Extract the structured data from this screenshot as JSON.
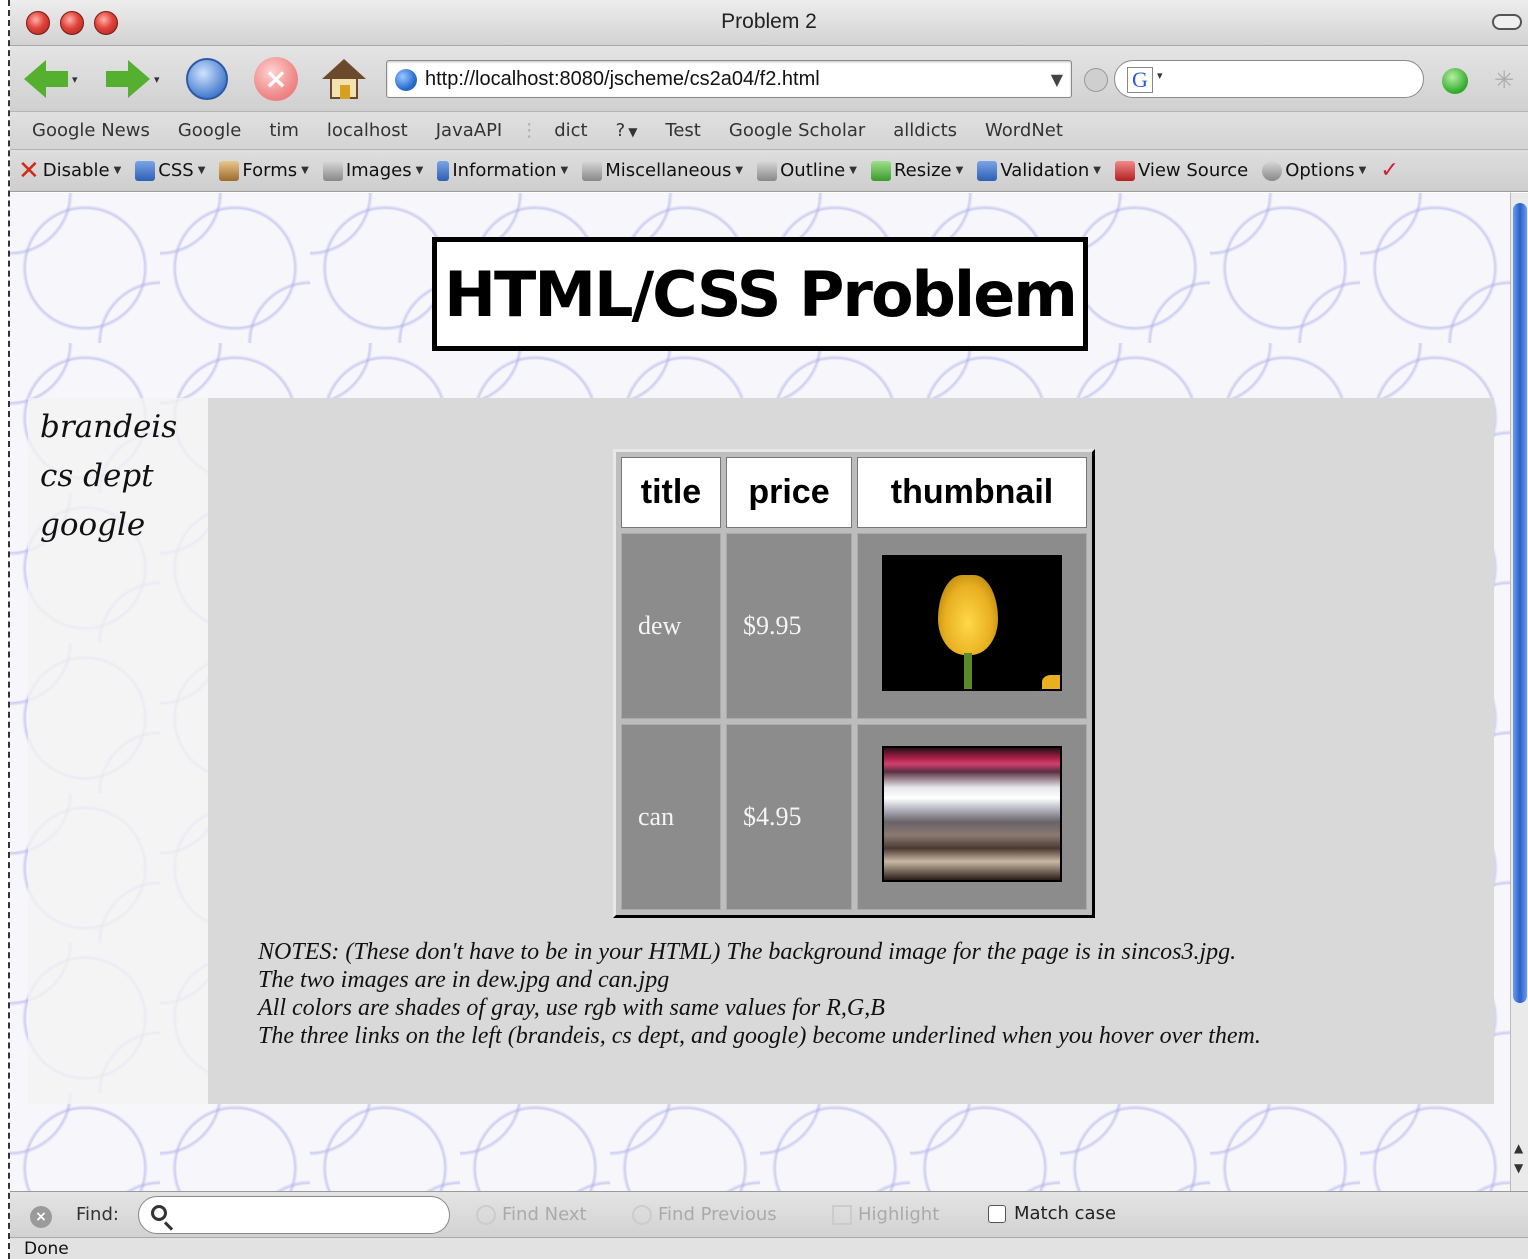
{
  "window": {
    "title": "Problem 2"
  },
  "navigation": {
    "url": "http://localhost:8080/jscheme/cs2a04/f2.html",
    "search_placeholder": ""
  },
  "bookmarks": [
    "Google News",
    "Google",
    "tim",
    "localhost",
    "JavaAPI",
    "dict",
    "?",
    "Test",
    "Google Scholar",
    "alldicts",
    "WordNet"
  ],
  "devbar": {
    "items": [
      {
        "label": "Disable",
        "icon": "x-icon"
      },
      {
        "label": "CSS",
        "icon": "css-icon"
      },
      {
        "label": "Forms",
        "icon": "forms-icon"
      },
      {
        "label": "Images",
        "icon": "images-icon"
      },
      {
        "label": "Information",
        "icon": "information-icon"
      },
      {
        "label": "Miscellaneous",
        "icon": "miscellaneous-icon"
      },
      {
        "label": "Outline",
        "icon": "outline-icon"
      },
      {
        "label": "Resize",
        "icon": "resize-icon"
      },
      {
        "label": "Validation",
        "icon": "validation-icon"
      },
      {
        "label": "View Source",
        "icon": "view-source-icon"
      },
      {
        "label": "Options",
        "icon": "options-icon"
      }
    ]
  },
  "page": {
    "heading": "HTML/CSS Problem",
    "links": [
      "brandeis",
      "cs dept",
      "google"
    ],
    "table": {
      "headers": [
        "title",
        "price",
        "thumbnail"
      ],
      "rows": [
        {
          "title": "dew",
          "price": "$9.95",
          "thumbnail": "tulip-thumbnail"
        },
        {
          "title": "can",
          "price": "$4.95",
          "thumbnail": "blur-thumbnail"
        }
      ]
    },
    "notes": [
      "NOTES: (These don't have to be in your HTML) The background image for the page is in sincos3.jpg.",
      "The two images are in dew.jpg and can.jpg",
      "All colors are shades of gray, use rgb with same values for R,G,B",
      "The three links on the left (brandeis, cs dept, and google) become underlined when you hover over them."
    ]
  },
  "findbar": {
    "label": "Find:",
    "find_next": "Find Next",
    "find_previous": "Find Previous",
    "highlight": "Highlight",
    "match_case": "Match case"
  },
  "status": {
    "text": "Done"
  },
  "colors": {
    "content_bg": "#d9d9d9",
    "cell_bg": "#8c8c8c",
    "nav_bg": "#f4f4f4"
  }
}
